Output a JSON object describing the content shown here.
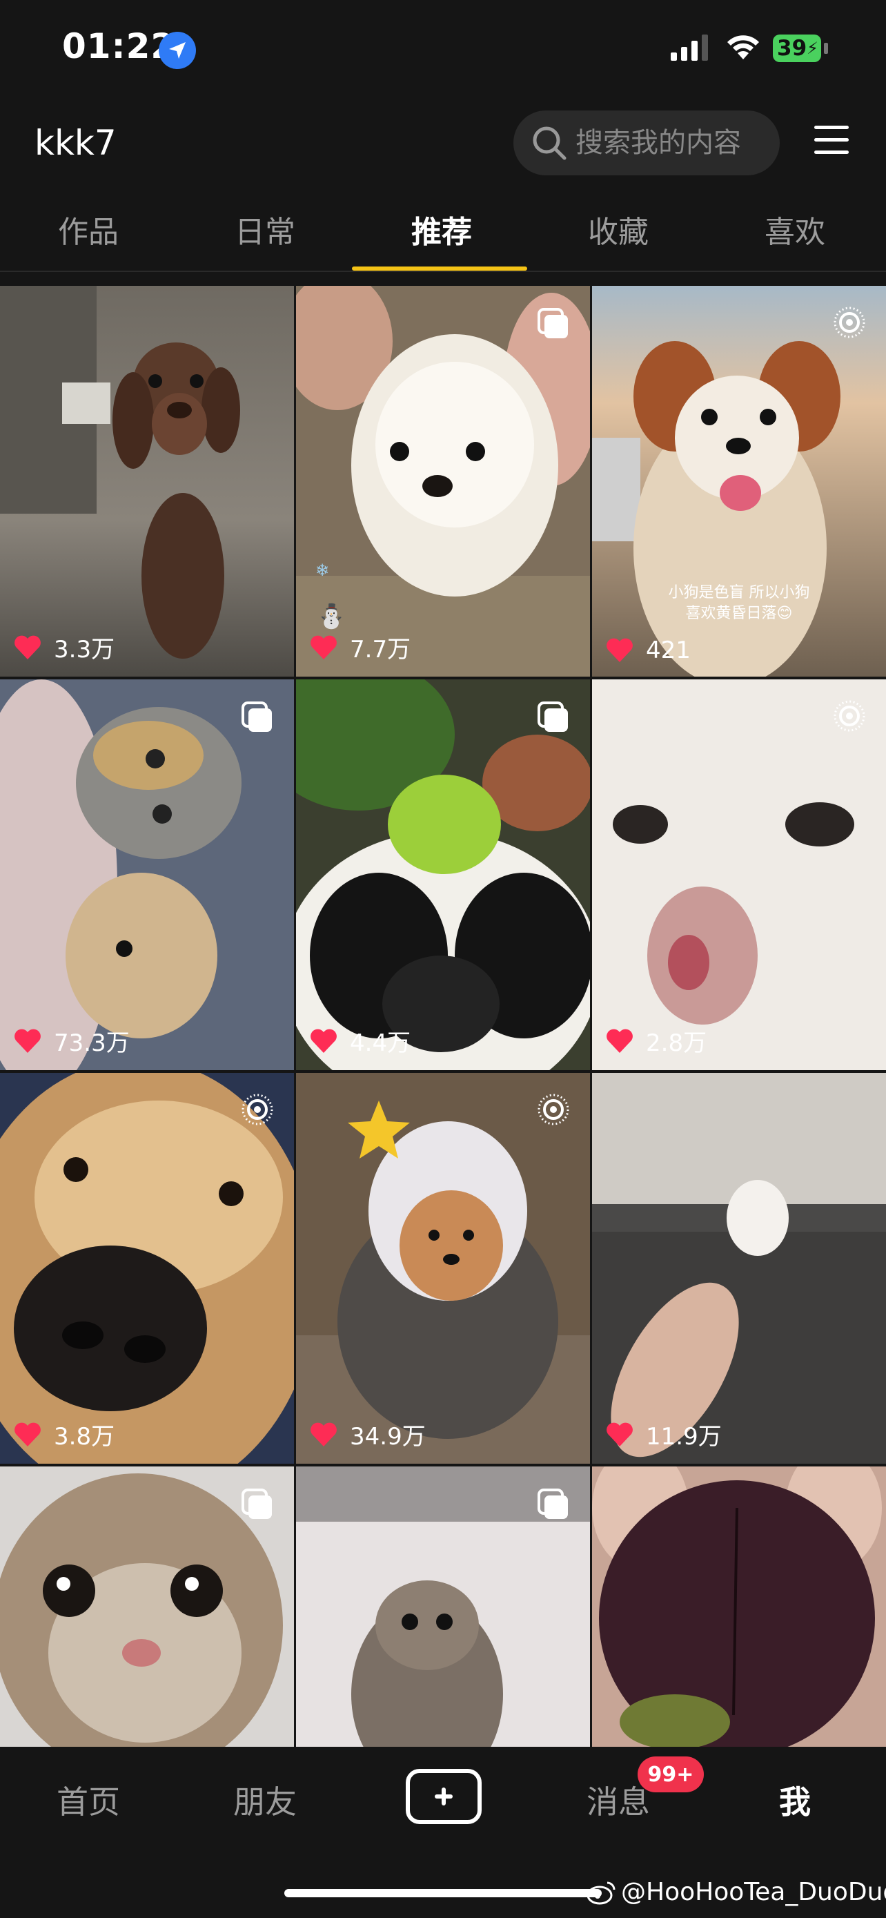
{
  "status_bar": {
    "time": "01:22",
    "battery": "39"
  },
  "header": {
    "username": "kkk7",
    "search_placeholder": "搜索我的内容"
  },
  "tabs": [
    {
      "label": "作品"
    },
    {
      "label": "日常"
    },
    {
      "label": "推荐",
      "active": true
    },
    {
      "label": "收藏"
    },
    {
      "label": "喜欢"
    }
  ],
  "posts": [
    {
      "likes": "3.3万",
      "badge": "",
      "subject": "dachshund"
    },
    {
      "likes": "7.7万",
      "badge": "multi",
      "subject": "white pomeranian"
    },
    {
      "likes": "421",
      "badge": "live",
      "subject": "papillon sunset",
      "caption": [
        "小狗是色盲 所以小狗",
        "喜欢黄昏日落😊"
      ]
    },
    {
      "likes": "73.3万",
      "badge": "multi",
      "subject": "cat and plush"
    },
    {
      "likes": "4.4万",
      "badge": "multi",
      "subject": "dog with lime"
    },
    {
      "likes": "2.8万",
      "badge": "live",
      "subject": "white puppy closeup"
    },
    {
      "likes": "3.8万",
      "badge": "live",
      "subject": "golden retriever nose"
    },
    {
      "likes": "34.9万",
      "badge": "live",
      "subject": "poodle in hat"
    },
    {
      "likes": "11.9万",
      "badge": "",
      "subject": "puppy on sofa"
    },
    {
      "likes": "",
      "badge": "multi",
      "subject": "tabby cat face"
    },
    {
      "likes": "",
      "badge": "multi",
      "subject": "scottish fold kitten"
    },
    {
      "likes": "",
      "badge": "",
      "subject": "purple fruit"
    }
  ],
  "bottom_nav": [
    {
      "label": "首页"
    },
    {
      "label": "朋友"
    },
    {
      "label": "消息",
      "badge": "99+"
    },
    {
      "label": "我",
      "active": true
    }
  ],
  "watermark": "@HooHooTea_DuoDuo",
  "colors": {
    "accent": "#f5c316",
    "like": "#fe2c55",
    "badge": "#f0324c"
  }
}
